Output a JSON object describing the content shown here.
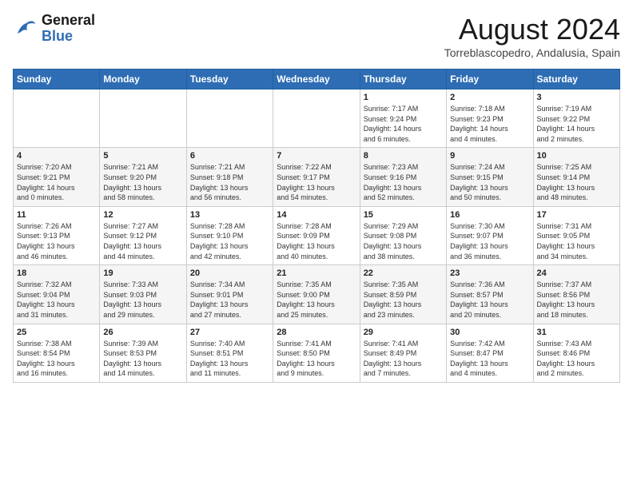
{
  "header": {
    "logo_general": "General",
    "logo_blue": "Blue",
    "month": "August 2024",
    "location": "Torreblascopedro, Andalusia, Spain"
  },
  "weekdays": [
    "Sunday",
    "Monday",
    "Tuesday",
    "Wednesday",
    "Thursday",
    "Friday",
    "Saturday"
  ],
  "weeks": [
    [
      {
        "day": "",
        "info": ""
      },
      {
        "day": "",
        "info": ""
      },
      {
        "day": "",
        "info": ""
      },
      {
        "day": "",
        "info": ""
      },
      {
        "day": "1",
        "info": "Sunrise: 7:17 AM\nSunset: 9:24 PM\nDaylight: 14 hours\nand 6 minutes."
      },
      {
        "day": "2",
        "info": "Sunrise: 7:18 AM\nSunset: 9:23 PM\nDaylight: 14 hours\nand 4 minutes."
      },
      {
        "day": "3",
        "info": "Sunrise: 7:19 AM\nSunset: 9:22 PM\nDaylight: 14 hours\nand 2 minutes."
      }
    ],
    [
      {
        "day": "4",
        "info": "Sunrise: 7:20 AM\nSunset: 9:21 PM\nDaylight: 14 hours\nand 0 minutes."
      },
      {
        "day": "5",
        "info": "Sunrise: 7:21 AM\nSunset: 9:20 PM\nDaylight: 13 hours\nand 58 minutes."
      },
      {
        "day": "6",
        "info": "Sunrise: 7:21 AM\nSunset: 9:18 PM\nDaylight: 13 hours\nand 56 minutes."
      },
      {
        "day": "7",
        "info": "Sunrise: 7:22 AM\nSunset: 9:17 PM\nDaylight: 13 hours\nand 54 minutes."
      },
      {
        "day": "8",
        "info": "Sunrise: 7:23 AM\nSunset: 9:16 PM\nDaylight: 13 hours\nand 52 minutes."
      },
      {
        "day": "9",
        "info": "Sunrise: 7:24 AM\nSunset: 9:15 PM\nDaylight: 13 hours\nand 50 minutes."
      },
      {
        "day": "10",
        "info": "Sunrise: 7:25 AM\nSunset: 9:14 PM\nDaylight: 13 hours\nand 48 minutes."
      }
    ],
    [
      {
        "day": "11",
        "info": "Sunrise: 7:26 AM\nSunset: 9:13 PM\nDaylight: 13 hours\nand 46 minutes."
      },
      {
        "day": "12",
        "info": "Sunrise: 7:27 AM\nSunset: 9:12 PM\nDaylight: 13 hours\nand 44 minutes."
      },
      {
        "day": "13",
        "info": "Sunrise: 7:28 AM\nSunset: 9:10 PM\nDaylight: 13 hours\nand 42 minutes."
      },
      {
        "day": "14",
        "info": "Sunrise: 7:28 AM\nSunset: 9:09 PM\nDaylight: 13 hours\nand 40 minutes."
      },
      {
        "day": "15",
        "info": "Sunrise: 7:29 AM\nSunset: 9:08 PM\nDaylight: 13 hours\nand 38 minutes."
      },
      {
        "day": "16",
        "info": "Sunrise: 7:30 AM\nSunset: 9:07 PM\nDaylight: 13 hours\nand 36 minutes."
      },
      {
        "day": "17",
        "info": "Sunrise: 7:31 AM\nSunset: 9:05 PM\nDaylight: 13 hours\nand 34 minutes."
      }
    ],
    [
      {
        "day": "18",
        "info": "Sunrise: 7:32 AM\nSunset: 9:04 PM\nDaylight: 13 hours\nand 31 minutes."
      },
      {
        "day": "19",
        "info": "Sunrise: 7:33 AM\nSunset: 9:03 PM\nDaylight: 13 hours\nand 29 minutes."
      },
      {
        "day": "20",
        "info": "Sunrise: 7:34 AM\nSunset: 9:01 PM\nDaylight: 13 hours\nand 27 minutes."
      },
      {
        "day": "21",
        "info": "Sunrise: 7:35 AM\nSunset: 9:00 PM\nDaylight: 13 hours\nand 25 minutes."
      },
      {
        "day": "22",
        "info": "Sunrise: 7:35 AM\nSunset: 8:59 PM\nDaylight: 13 hours\nand 23 minutes."
      },
      {
        "day": "23",
        "info": "Sunrise: 7:36 AM\nSunset: 8:57 PM\nDaylight: 13 hours\nand 20 minutes."
      },
      {
        "day": "24",
        "info": "Sunrise: 7:37 AM\nSunset: 8:56 PM\nDaylight: 13 hours\nand 18 minutes."
      }
    ],
    [
      {
        "day": "25",
        "info": "Sunrise: 7:38 AM\nSunset: 8:54 PM\nDaylight: 13 hours\nand 16 minutes."
      },
      {
        "day": "26",
        "info": "Sunrise: 7:39 AM\nSunset: 8:53 PM\nDaylight: 13 hours\nand 14 minutes."
      },
      {
        "day": "27",
        "info": "Sunrise: 7:40 AM\nSunset: 8:51 PM\nDaylight: 13 hours\nand 11 minutes."
      },
      {
        "day": "28",
        "info": "Sunrise: 7:41 AM\nSunset: 8:50 PM\nDaylight: 13 hours\nand 9 minutes."
      },
      {
        "day": "29",
        "info": "Sunrise: 7:41 AM\nSunset: 8:49 PM\nDaylight: 13 hours\nand 7 minutes."
      },
      {
        "day": "30",
        "info": "Sunrise: 7:42 AM\nSunset: 8:47 PM\nDaylight: 13 hours\nand 4 minutes."
      },
      {
        "day": "31",
        "info": "Sunrise: 7:43 AM\nSunset: 8:46 PM\nDaylight: 13 hours\nand 2 minutes."
      }
    ]
  ]
}
